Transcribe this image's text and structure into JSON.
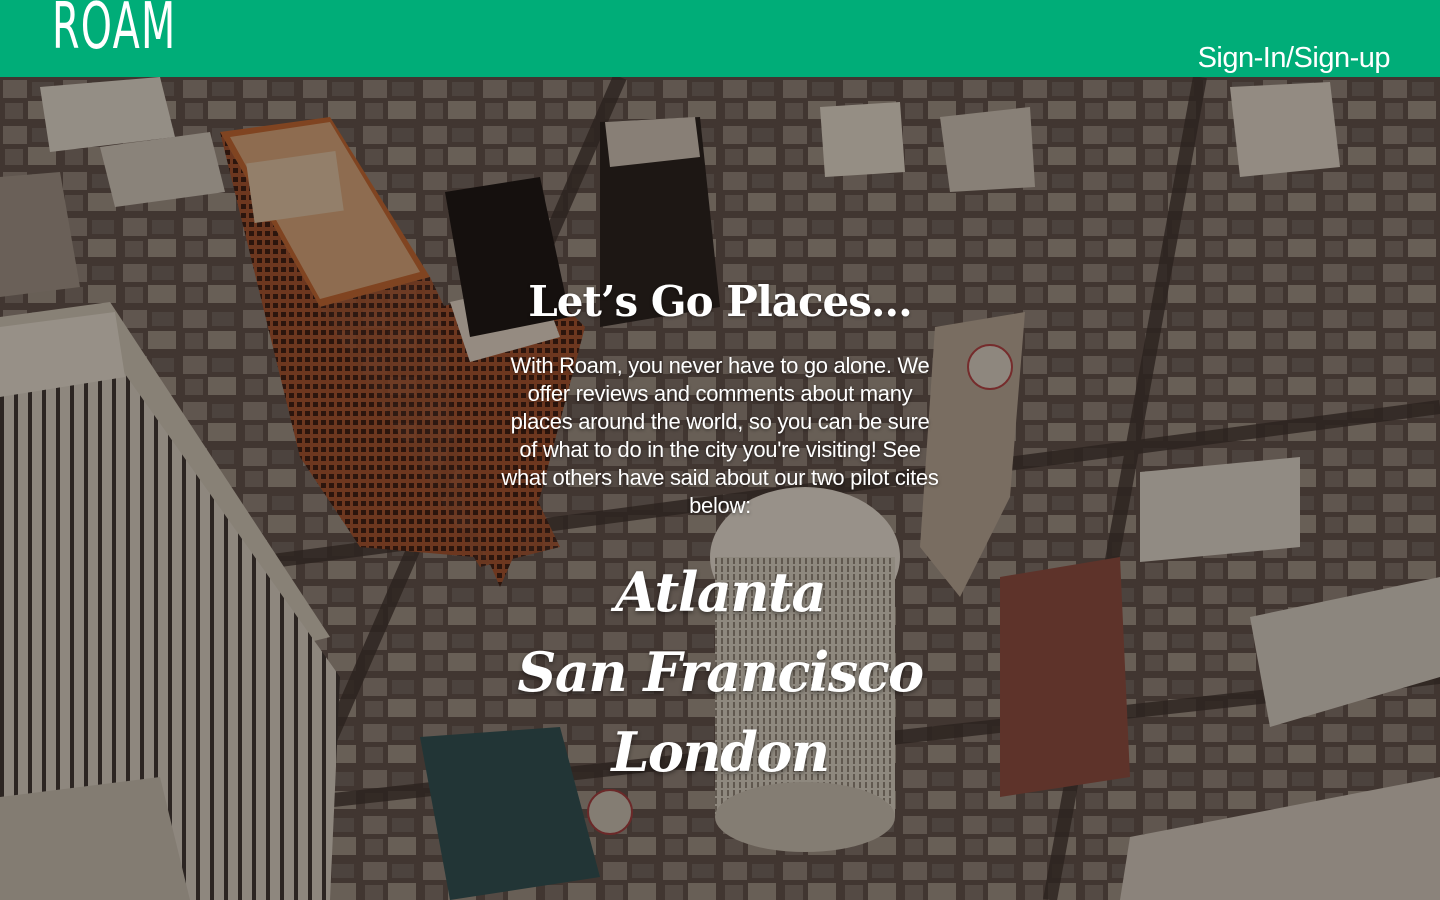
{
  "header": {
    "logo": "ROAM",
    "signin_label": "Sign-In/Sign-up",
    "bar_color": "#00ad78"
  },
  "hero": {
    "background_image": "aerial-city-skyline-photo",
    "headline": "Let’s Go Places...",
    "intro": "With Roam, you never have to go alone. We offer reviews and comments about many places around the world, so you can be sure of what to do in the city you're visiting! See what others have said about our two pilot cites below:",
    "cities": [
      {
        "label": "Atlanta"
      },
      {
        "label": "San Francisco"
      },
      {
        "label": "London"
      }
    ]
  }
}
